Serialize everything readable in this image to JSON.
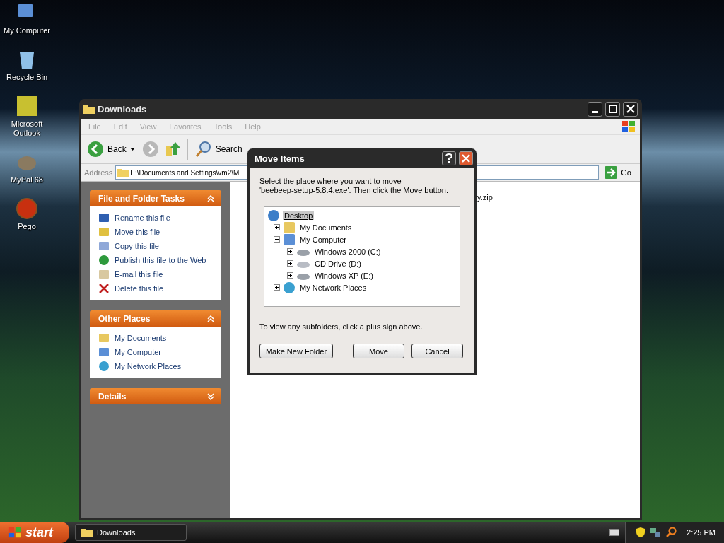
{
  "desktop_icons": [
    {
      "label": "My Computer",
      "kind": "computer"
    },
    {
      "label": "Recycle Bin",
      "kind": "recycle"
    },
    {
      "label": "Microsoft Outlook",
      "kind": "outlook"
    },
    {
      "label": "MyPal 68",
      "kind": "raccoon"
    },
    {
      "label": "Pego",
      "kind": "ball"
    }
  ],
  "window": {
    "title": "Downloads",
    "menu": [
      "File",
      "Edit",
      "View",
      "Favorites",
      "Tools",
      "Help"
    ],
    "toolbar": {
      "back": "Back",
      "search": "Search"
    },
    "address": {
      "label": "Address",
      "value": "E:\\Documents and Settings\\vm2\\M",
      "go": "Go"
    },
    "task_panels": [
      {
        "title": "File and Folder Tasks",
        "expanded": true,
        "items": [
          {
            "label": "Rename this file",
            "kind": "rename"
          },
          {
            "label": "Move this file",
            "kind": "move"
          },
          {
            "label": "Copy this file",
            "kind": "copy"
          },
          {
            "label": "Publish this file to the Web",
            "kind": "web"
          },
          {
            "label": "E-mail this file",
            "kind": "mail"
          },
          {
            "label": "Delete this file",
            "kind": "delete"
          }
        ]
      },
      {
        "title": "Other Places",
        "expanded": true,
        "items": [
          {
            "label": "My Documents",
            "kind": "documents"
          },
          {
            "label": "My Computer",
            "kind": "computer"
          },
          {
            "label": "My Network Places",
            "kind": "network"
          }
        ]
      },
      {
        "title": "Details",
        "expanded": false
      }
    ],
    "files": [
      {
        "name": "y.zip"
      }
    ]
  },
  "dialog": {
    "title": "Move Items",
    "message_lines": [
      "Select the place where you want to move",
      "'beebeep-setup-5.8.4.exe'. Then click the Move button."
    ],
    "tree": [
      {
        "label": "Desktop",
        "kind": "desktop",
        "selected": true,
        "children": [
          {
            "label": "My Documents",
            "kind": "documents",
            "expanded": false,
            "selected": false
          },
          {
            "label": "My Computer",
            "kind": "computer",
            "expanded": true,
            "selected": false,
            "children": [
              {
                "label": "Windows 2000 (C:)",
                "kind": "drive",
                "expanded": false,
                "selected": false
              },
              {
                "label": "CD Drive (D:)",
                "kind": "cd",
                "expanded": false,
                "selected": false
              },
              {
                "label": "Windows XP (E:)",
                "kind": "drive",
                "expanded": false,
                "selected": false
              }
            ]
          },
          {
            "label": "My Network Places",
            "kind": "network",
            "expanded": false,
            "selected": false
          }
        ]
      }
    ],
    "hint": "To view any subfolders, click a plus sign above.",
    "buttons": [
      {
        "label": "Make New Folder",
        "kind": "new"
      },
      {
        "label": "Move",
        "kind": "ok"
      },
      {
        "label": "Cancel",
        "kind": "cancel"
      }
    ]
  },
  "taskbar": {
    "start": "start",
    "tasks": [
      {
        "label": "Downloads",
        "selected": false
      }
    ],
    "clock": "2:25 PM"
  }
}
